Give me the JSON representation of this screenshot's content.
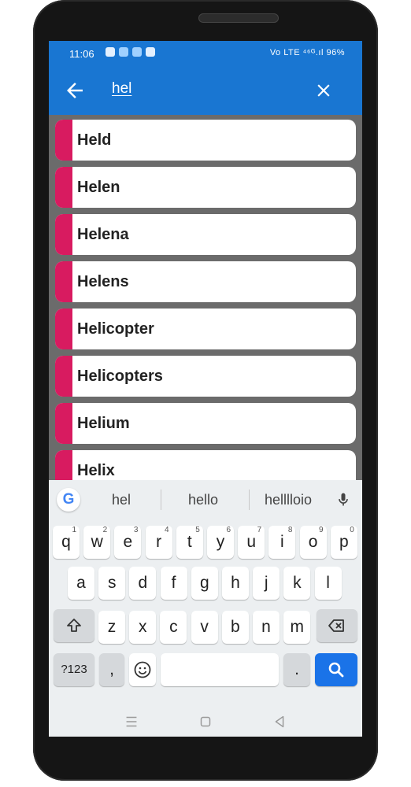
{
  "status_bar": {
    "time": "11:06",
    "right_text": "Vo LTE ⁴⁶ᴳ.ıl 96%"
  },
  "search": {
    "query": "hel",
    "back_icon": "arrow-left-icon",
    "clear_icon": "close-icon"
  },
  "results": [
    {
      "label": "Held"
    },
    {
      "label": "Helen"
    },
    {
      "label": "Helena"
    },
    {
      "label": "Helens"
    },
    {
      "label": "Helicopter"
    },
    {
      "label": "Helicopters"
    },
    {
      "label": "Helium"
    },
    {
      "label": "Helix"
    }
  ],
  "keyboard": {
    "suggestions": [
      "hel",
      "hello",
      "helllloio"
    ],
    "row1": [
      {
        "k": "q",
        "h": "1"
      },
      {
        "k": "w",
        "h": "2"
      },
      {
        "k": "e",
        "h": "3"
      },
      {
        "k": "r",
        "h": "4"
      },
      {
        "k": "t",
        "h": "5"
      },
      {
        "k": "y",
        "h": "6"
      },
      {
        "k": "u",
        "h": "7"
      },
      {
        "k": "i",
        "h": "8"
      },
      {
        "k": "o",
        "h": "9"
      },
      {
        "k": "p",
        "h": "0"
      }
    ],
    "row2": [
      "a",
      "s",
      "d",
      "f",
      "g",
      "h",
      "j",
      "k",
      "l"
    ],
    "row3": [
      "z",
      "x",
      "c",
      "v",
      "b",
      "n",
      "m"
    ],
    "symbols_label": "?123",
    "comma_label": ",",
    "period_label": ".",
    "accent_color": "#1a73e8"
  }
}
